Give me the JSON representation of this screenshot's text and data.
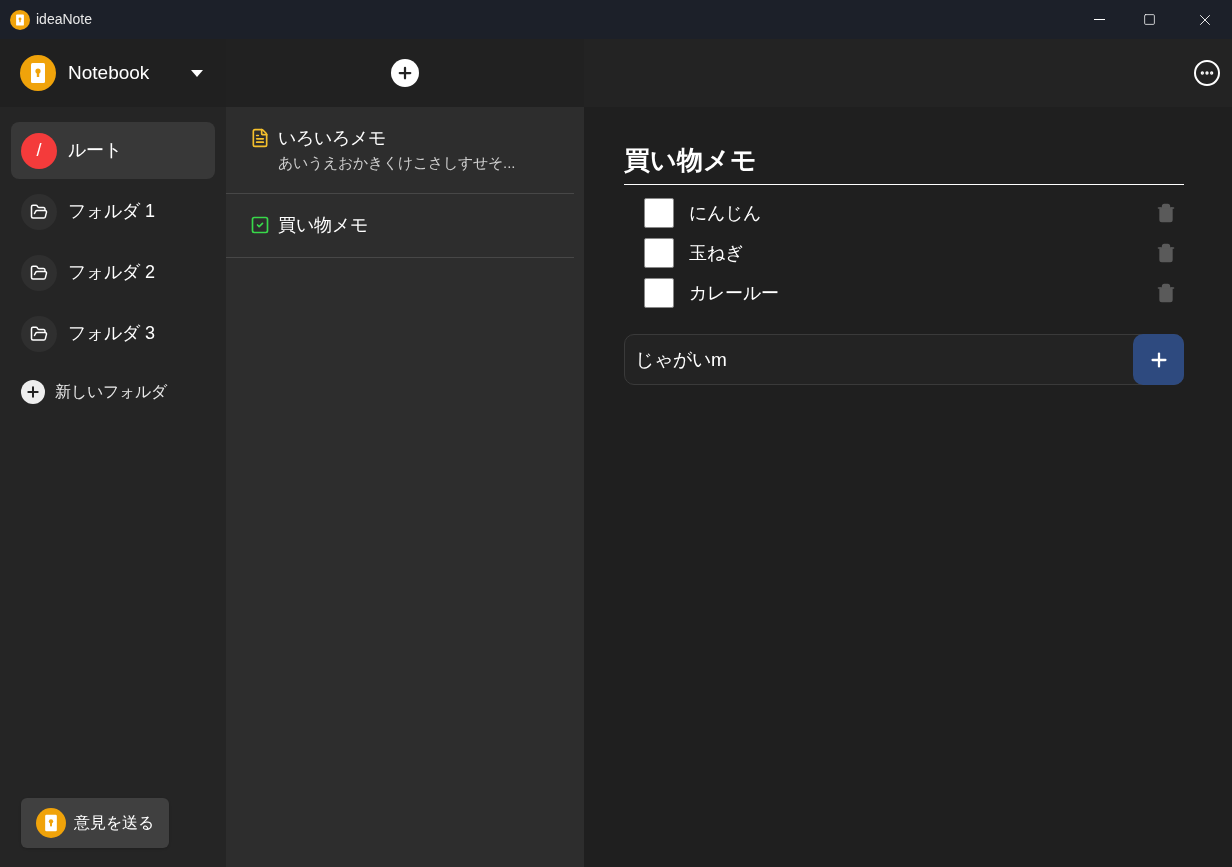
{
  "window": {
    "title": "ideaNote"
  },
  "sidebar": {
    "notebook": "Notebook",
    "folders": [
      {
        "kind": "root",
        "icon_text": "/",
        "label": "ルート",
        "selected": true
      },
      {
        "kind": "folder",
        "label": "フォルダ 1",
        "selected": false
      },
      {
        "kind": "folder",
        "label": "フォルダ 2",
        "selected": false
      },
      {
        "kind": "folder",
        "label": "フォルダ 3",
        "selected": false
      }
    ],
    "new_folder": "新しいフォルダ",
    "feedback": "意見を送る"
  },
  "notes": [
    {
      "kind": "text",
      "title": "いろいろメモ",
      "preview": "あいうえおかきくけこさしすせそ..."
    },
    {
      "kind": "checklist",
      "title": "買い物メモ"
    }
  ],
  "editor": {
    "title": "買い物メモ",
    "items": [
      {
        "text": "にんじん",
        "checked": false
      },
      {
        "text": "玉ねぎ",
        "checked": false
      },
      {
        "text": "カレールー",
        "checked": false
      }
    ],
    "new_item": {
      "value": "じゃがいm"
    }
  }
}
